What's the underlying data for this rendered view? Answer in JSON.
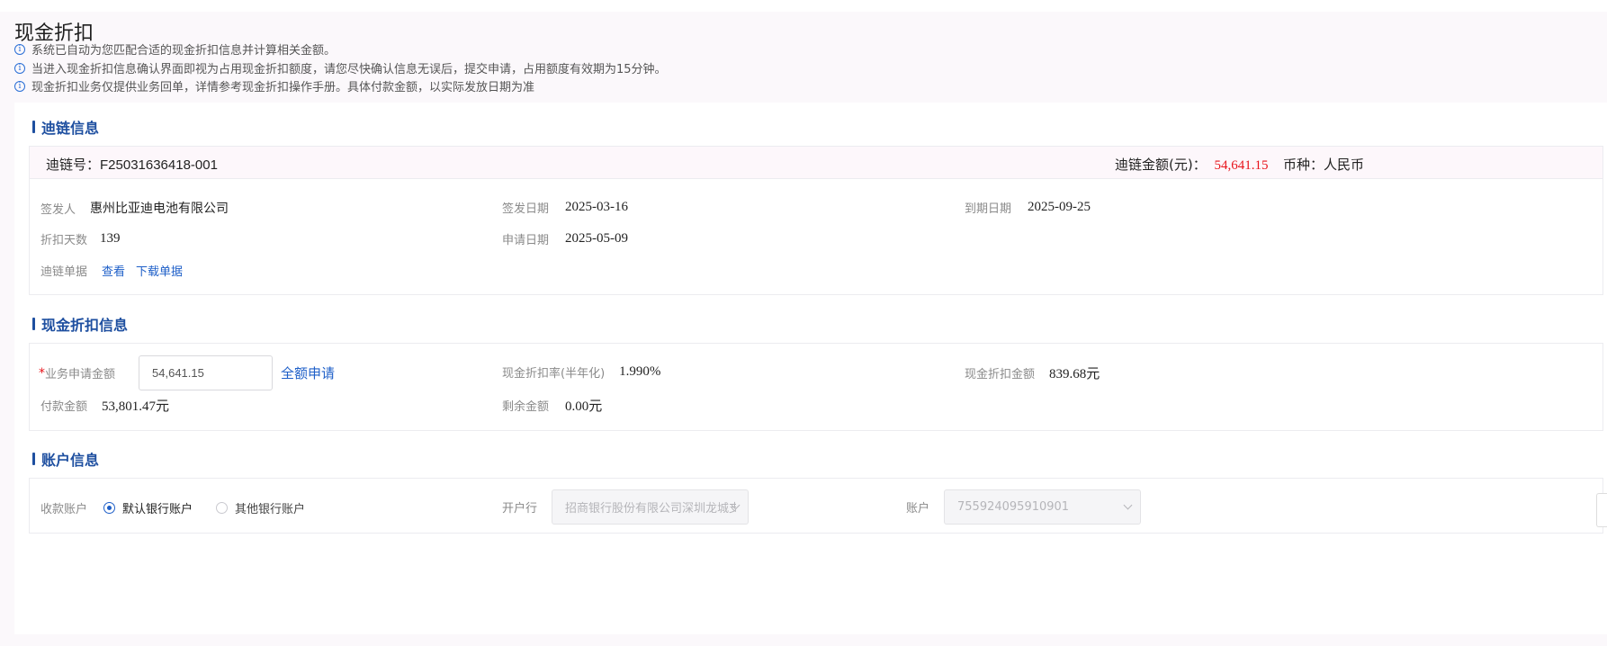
{
  "title": "现金折扣",
  "notices": [
    "系统已自动为您匹配合适的现金折扣信息并计算相关金额。",
    "当进入现金折扣信息确认界面即视为占用现金折扣额度，请您尽快确认信息无误后，提交申请，占用额度有效期为15分钟。",
    "现金折扣业务仅提供业务回单，详情参考现金折扣操作手册。具体付款金额，以实际发放日期为准"
  ],
  "chain": {
    "section_title": "迪链信息",
    "chain_no": "迪链号：F25031636418-001",
    "amount_label": "迪链金额(元)：",
    "amount_value": "54,641.15",
    "currency": "币种：人民币",
    "issuer_label": "签发人",
    "issuer_value": "惠州比亚迪电池有限公司",
    "issue_date_label": "签发日期",
    "issue_date_value": "2025-03-16",
    "due_date_label": "到期日期",
    "due_date_value": "2025-09-25",
    "discount_days_label": "折扣天数",
    "discount_days_value": "139",
    "apply_date_label": "申请日期",
    "apply_date_value": "2025-05-09",
    "doc_label": "迪链单据",
    "view_link": "查看",
    "download_link": "下载单据"
  },
  "discount": {
    "section_title": "现金折扣信息",
    "required_mark": "*",
    "apply_amount_label": "业务申请金额",
    "apply_amount_value": "54,641.15",
    "full_apply": "全额申请",
    "rate_label": "现金折扣率(半年化)",
    "rate_value": "1.990%",
    "discount_amount_label": "现金折扣金额",
    "discount_amount_value": "839.68元",
    "pay_amount_label": "付款金额",
    "pay_amount_value": "53,801.47元",
    "remain_label": "剩余金额",
    "remain_value": "0.00元"
  },
  "account": {
    "section_title": "账户信息",
    "receive_label": "收款账户",
    "option_default": "默认银行账户",
    "option_other": "其他银行账户",
    "selected": "默认银行账户",
    "bank_label": "开户行",
    "bank_value": "招商银行股份有限公司深圳龙城支行",
    "acct_label": "账户",
    "acct_value": "755924095910901"
  },
  "colors": {
    "accent": "#1e5fc8",
    "amount_red": "#e8141b",
    "section_blue": "#1e4fa0"
  }
}
